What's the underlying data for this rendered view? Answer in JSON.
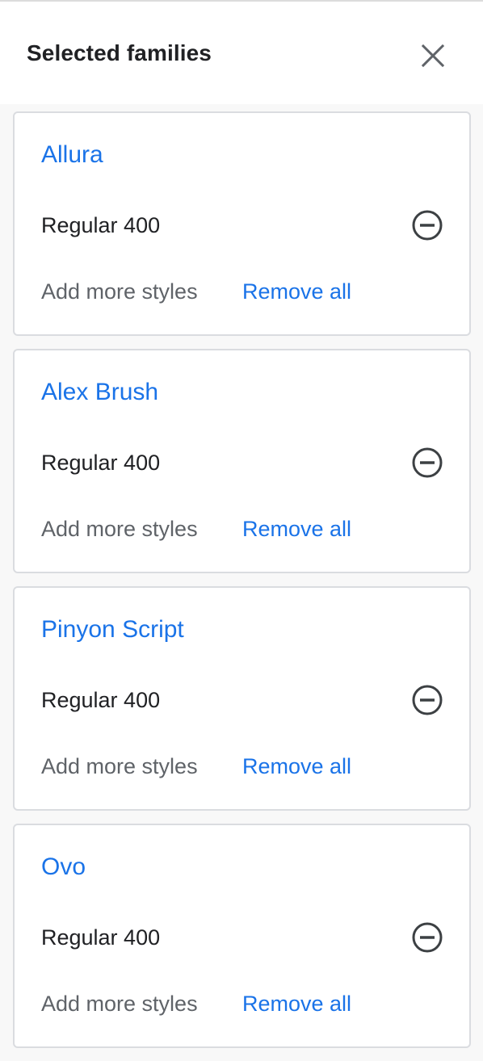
{
  "header": {
    "title": "Selected families",
    "close_icon": "close-icon"
  },
  "families": [
    {
      "name": "Allura",
      "style": "Regular 400",
      "add_more_label": "Add more styles",
      "remove_all_label": "Remove all",
      "remove_style_icon": "remove-circle-icon"
    },
    {
      "name": "Alex Brush",
      "style": "Regular 400",
      "add_more_label": "Add more styles",
      "remove_all_label": "Remove all",
      "remove_style_icon": "remove-circle-icon"
    },
    {
      "name": "Pinyon Script",
      "style": "Regular 400",
      "add_more_label": "Add more styles",
      "remove_all_label": "Remove all",
      "remove_style_icon": "remove-circle-icon"
    },
    {
      "name": "Ovo",
      "style": "Regular 400",
      "add_more_label": "Add more styles",
      "remove_all_label": "Remove all",
      "remove_style_icon": "remove-circle-icon"
    }
  ],
  "colors": {
    "accent": "#1a73e8",
    "text_primary": "#202124",
    "text_secondary": "#5f6368",
    "border": "#dadce0",
    "panel_background": "#f8f8f8"
  }
}
